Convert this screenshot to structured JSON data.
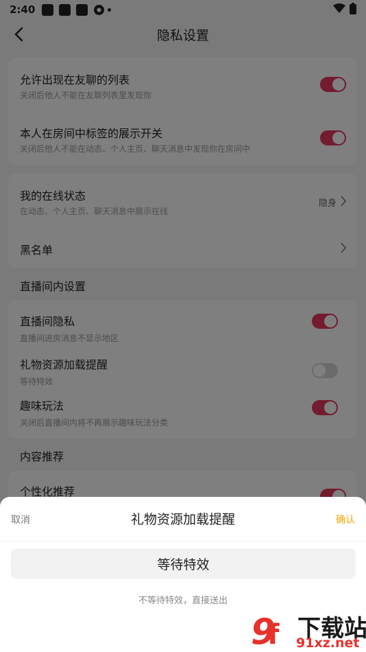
{
  "status_bar": {
    "time": "2:40"
  },
  "nav": {
    "title": "隐私设置"
  },
  "card1": {
    "rows": [
      {
        "title": "允许出现在友聊的列表",
        "subtitle": "关闭后他人不能在友聊列表里发现你",
        "toggle": "on"
      },
      {
        "title": "本人在房间中标签的展示开关",
        "subtitle": "关闭后他人不能在动态、个人主页、聊天消息中发现你在房间中",
        "toggle": "on"
      }
    ]
  },
  "card2": {
    "rows": [
      {
        "title": "我的在线状态",
        "subtitle": "在动态、个人主页、聊天消息中展示在线",
        "value": "隐身"
      },
      {
        "title": "黑名单"
      }
    ]
  },
  "section_live": {
    "label": "直播间内设置"
  },
  "card3": {
    "rows": [
      {
        "title": "直播间隐私",
        "subtitle": "直播间进房消息不显示地区",
        "toggle": "on"
      },
      {
        "title": "礼物资源加载提醒",
        "subtitle": "等待特效",
        "toggle": "off"
      },
      {
        "title": "趣味玩法",
        "subtitle": "关闭后直播间内将不再展示趣味玩法分类",
        "toggle": "on"
      }
    ]
  },
  "section_content": {
    "label": "内容推荐"
  },
  "card4": {
    "rows": [
      {
        "title": "个性化推荐",
        "toggle": "on"
      }
    ]
  },
  "sheet": {
    "cancel": "取消",
    "title": "礼物资源加载提醒",
    "confirm": "确认",
    "option_selected": "等待特效",
    "option_other": "不等待特效，直接送出"
  },
  "watermark": {
    "brand": "下载站",
    "url": "91xz.net"
  },
  "colors": {
    "toggle_on": "#e6375f",
    "confirm": "#f2a800"
  }
}
